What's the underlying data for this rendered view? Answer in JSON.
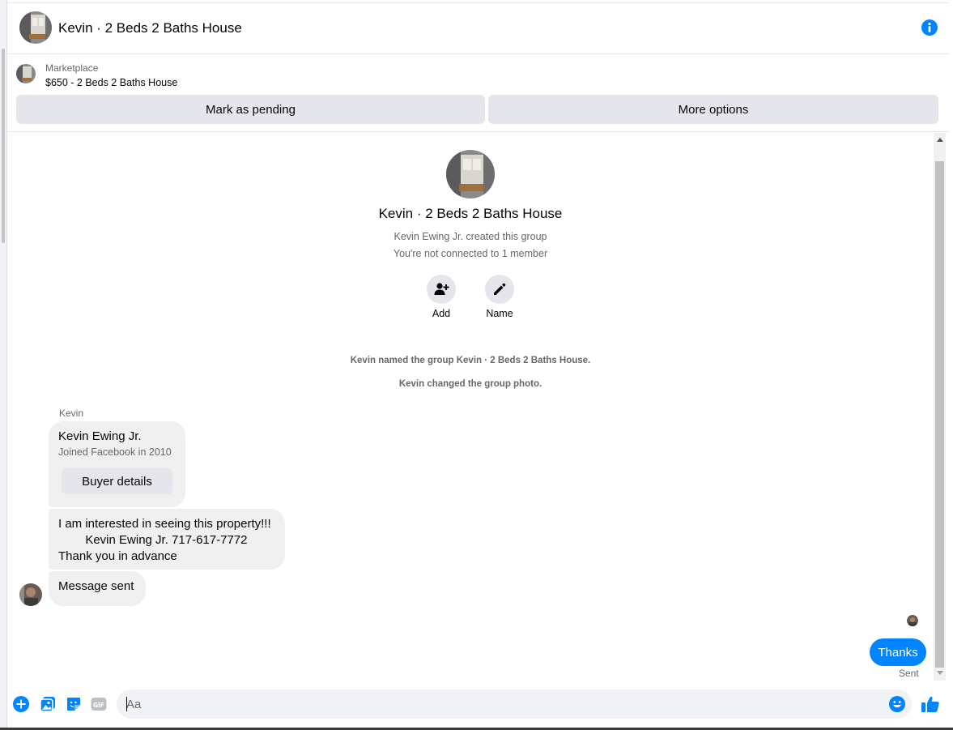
{
  "header": {
    "title": "Kevin · 2 Beds 2 Baths House",
    "icons": [
      "group-photo-avatar",
      "info-icon"
    ]
  },
  "marketplace": {
    "label": "Marketplace",
    "listing": "$650 - 2 Beds 2 Baths House",
    "mark_pending_label": "Mark as pending",
    "more_options_label": "More options"
  },
  "group": {
    "name": "Kevin · 2 Beds 2 Baths House",
    "created_by": "Kevin Ewing Jr. created this group",
    "connection": "You're not connected to 1 member",
    "add_label": "Add",
    "name_label": "Name"
  },
  "system_messages": {
    "renamed": "Kevin named the group Kevin · 2 Beds 2 Baths House.",
    "photo_changed": "Kevin changed the group photo."
  },
  "messages": {
    "sender_name": "Kevin",
    "profile_card": {
      "name": "Kevin Ewing Jr.",
      "joined": "Joined Facebook in 2010",
      "button": "Buyer details"
    },
    "text_message": {
      "line1": "I am interested in seeing this property!!!",
      "line2": "        Kevin Ewing Jr. 717-617-7772",
      "line3": "Thank you in advance"
    },
    "message_sent": "Message sent",
    "my_reply": "Thanks",
    "status": "Sent"
  },
  "composer": {
    "placeholder": "Aa",
    "icons": [
      "plus-icon",
      "photo-icon",
      "sticker-icon",
      "gif-icon",
      "emoji-icon",
      "like-icon"
    ]
  },
  "colors": {
    "accent": "#0084ff",
    "bubble_gray": "#f0f0f0",
    "button_gray": "#e4e6eb",
    "secondary_text": "#65676b"
  }
}
